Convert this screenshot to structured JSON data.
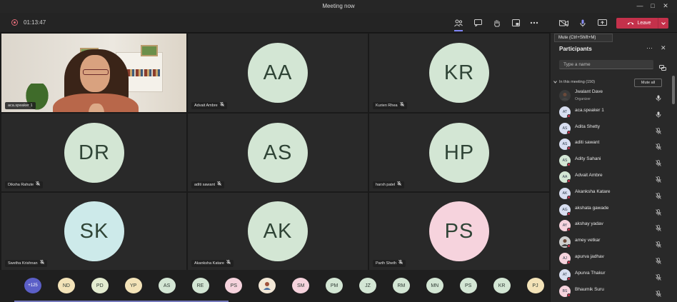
{
  "window": {
    "title": "Meeting now"
  },
  "toolbar": {
    "timer": "01:13:47",
    "leave_label": "Leave",
    "tooltip": "Mute (Ctrl+Shift+M)"
  },
  "tiles": [
    {
      "type": "video",
      "name": "aca.speaker 1"
    },
    {
      "initials": "AA",
      "name": "Advait Ambre",
      "color": "#d3e6d4"
    },
    {
      "initials": "KR",
      "name": "Kurien Rhea",
      "color": "#d3e6d4"
    },
    {
      "initials": "DR",
      "name": "Diksha Rahute",
      "color": "#d3e6d4"
    },
    {
      "initials": "AS",
      "name": "aditi sawant",
      "color": "#d3e6d4"
    },
    {
      "initials": "HP",
      "name": "harsh patel",
      "color": "#d3e6d4"
    },
    {
      "initials": "SK",
      "name": "Swetha Krishnan",
      "color": "#cdeaea"
    },
    {
      "initials": "AK",
      "name": "Akanksha Katare",
      "color": "#d3e6d4"
    },
    {
      "initials": "PS",
      "name": "Parth Sheth",
      "color": "#f6d3dd"
    }
  ],
  "strip": [
    {
      "label": "+125",
      "kind": "more"
    },
    {
      "label": "ND",
      "color": "#f3e3b8"
    },
    {
      "label": "PD",
      "color": "#e3ecd0"
    },
    {
      "label": "YP",
      "color": "#f3e3b8"
    },
    {
      "label": "AS",
      "color": "#d3e6d4"
    },
    {
      "label": "RE",
      "color": "#d3e6d4"
    },
    {
      "label": "PS",
      "color": "#f6d3dd"
    },
    {
      "label": "",
      "kind": "photo"
    },
    {
      "label": "SM",
      "color": "#f6d3dd"
    },
    {
      "label": "PM",
      "color": "#d3e6d4"
    },
    {
      "label": "JZ",
      "color": "#d3e6d4"
    },
    {
      "label": "RM",
      "color": "#d3e6d4"
    },
    {
      "label": "MN",
      "color": "#d3e6d4"
    },
    {
      "label": "PS",
      "color": "#d3e6d4"
    },
    {
      "label": "KR",
      "color": "#d3e6d4"
    },
    {
      "label": "PJ",
      "color": "#f3e3b8"
    }
  ],
  "panel": {
    "title": "Participants",
    "search_placeholder": "Type a name",
    "section_label": "In this meeting (150)",
    "mute_all": "Mute all",
    "participants": [
      {
        "name": "Jwalant Dave",
        "role": "Organizer",
        "initials": "",
        "color": "#3a3a3a",
        "mic": "on"
      },
      {
        "name": "aca.speaker 1",
        "role": "",
        "initials": "AT",
        "color": "#d8def0",
        "mic": "on"
      },
      {
        "name": "Adita Shetty",
        "role": "",
        "initials": "AS",
        "color": "#d8def0",
        "mic": "off"
      },
      {
        "name": "aditi sawant",
        "role": "",
        "initials": "AS",
        "color": "#d8def0",
        "mic": "off"
      },
      {
        "name": "Adity Sahani",
        "role": "",
        "initials": "AS",
        "color": "#d3e6d4",
        "mic": "off"
      },
      {
        "name": "Advait Ambre",
        "role": "",
        "initials": "AA",
        "color": "#d3e6d4",
        "mic": "off"
      },
      {
        "name": "Akanksha Katare",
        "role": "",
        "initials": "AK",
        "color": "#d8def0",
        "mic": "off"
      },
      {
        "name": "akshata gawade",
        "role": "",
        "initials": "AG",
        "color": "#d8def0",
        "mic": "off"
      },
      {
        "name": "akshay yadav",
        "role": "",
        "initials": "AY",
        "color": "#f6d3dd",
        "mic": "off"
      },
      {
        "name": "amey vetkar",
        "role": "",
        "initials": "",
        "color": "#cfcfcf",
        "mic": "off"
      },
      {
        "name": "apurva jadhav",
        "role": "",
        "initials": "AJ",
        "color": "#f6d3dd",
        "mic": "off"
      },
      {
        "name": "Apurva Thakur",
        "role": "",
        "initials": "AT",
        "color": "#d8def0",
        "mic": "off"
      },
      {
        "name": "Bhaumik Suru",
        "role": "",
        "initials": "BS",
        "color": "#f6d3dd",
        "mic": "off"
      }
    ]
  }
}
